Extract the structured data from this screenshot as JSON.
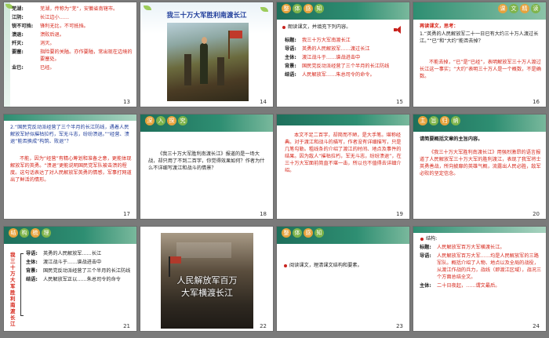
{
  "s13": {
    "num": "13",
    "rows": [
      {
        "k": "芜湖:",
        "v": "芜湖，传称为“芜”，安徽省南辖市。"
      },
      {
        "k": "江阴:",
        "v": "长江边小……"
      },
      {
        "k": "锐不可挡:",
        "v": "锋利无比，不可抵挡。"
      },
      {
        "k": "溃退:",
        "v": "溃败后退。"
      },
      {
        "k": "歼灭:",
        "v": "消灭。"
      },
      {
        "k": "要塞:",
        "v": "指险要的关隘。亦作要隘，常出现在边境的要塞处。"
      },
      {
        "k": "业已:",
        "v": "已经。"
      }
    ]
  },
  "s14": {
    "num": "14",
    "title": "我三十万大军胜利南渡长江"
  },
  "s15": {
    "num": "15",
    "tag": [
      "整",
      "体",
      "感",
      "知"
    ],
    "lead": "朗读课文，并填充下列内容。",
    "rows": [
      {
        "k": "标题:",
        "v": "我三十万大军南渡长江"
      },
      {
        "k": "导语:",
        "v": "英勇的人民解放军……渡过长江"
      },
      {
        "k": "主体:",
        "v": "渡江战斗于……谱战进击中"
      },
      {
        "k": "背景:",
        "v": "国民党反动派经营了三个半月的长江防线"
      },
      {
        "k": "结语:",
        "v": "人民解放军……朱总司令的命令。"
      }
    ]
  },
  "s16": {
    "num": "16",
    "tag": [
      "课",
      "文",
      "精",
      "读"
    ],
    "q_head": "再读课文，思考：",
    "q": "1.“英勇的人民解放军二十一日已有大约三十万人渡过长江。”“已”和“大约”能否去掉？",
    "a": "不能去掉，“已”是“已经”，表明解放军三十万人渡过长江这一事实；“大约”表明三十万人是一个概数，不是确数。"
  },
  "s17": {
    "num": "17",
    "q": "2.“国民党反动派经营了三个半月的长江防线，遇着人民解放军好似摧枯拉朽，军无斗志，纷纷溃退。”“经营、溃退”能否换成“构筑、败退”？",
    "a": "不能，因为“经营”有精心筹划和准备之意，更能体现解放军的英勇。“溃退”更能说明国民党军队被击溃的程度。这句话表达了对人民解放军英勇的情感，军事打网道出了鲜活的情形。"
  },
  "s18": {
    "num": "18",
    "tag": [
      "深",
      "入",
      "探",
      "究"
    ],
    "text": "《我三十万大军胜利南渡长江》报道的是一场大战，却只用了不到二百字，你觉得效果如何？作者为什么不详细写渡江和战斗的情景？"
  },
  "s19": {
    "num": "19",
    "text": "本文不足二百字，却简而不陋，是大手笔。堪称经典。对于渡江和战斗的描写，作者没有详细描写，只是几笔勾勒。粗线条的介绍了渡江的时间、地点及事件的结果。因为敌人“摧枯拉朽，军无斗志，纷纷溃退”，在三十万大军面前简直不堪一击，所以也不值得去详细介绍。"
  },
  "s20": {
    "num": "20",
    "tag": [
      "主",
      "旨",
      "归",
      "纳"
    ],
    "head": "请简要概括文章的主旨内容。",
    "text": "《我三十万大军胜利南渡长江》用强烈激昂的语言报道了人民解放军三十万大军的胜利渡江，表现了我军将士英勇善战，所向披靡的英雄气概，流露出人民必胜，敌军必败的坚定信念。"
  },
  "s21": {
    "num": "21",
    "tag": [
      "结",
      "构",
      "梳",
      "理"
    ],
    "side": "我三十万大军胜利南渡长江",
    "rows": [
      {
        "k": "导语:",
        "v": "英勇的人民解放军……长江"
      },
      {
        "k": "主体:",
        "v": "渡江战斗于……谱战进击中"
      },
      {
        "k": "背景:",
        "v": "国民党反动派经营了三个半月的长江防线"
      },
      {
        "k": "结语:",
        "v": "人民解放军正以……朱总司令的命令"
      }
    ]
  },
  "s22": {
    "num": "22",
    "poster_line1": "人民解放军百万",
    "poster_line2": "大军横渡长江"
  },
  "s23": {
    "num": "23",
    "tag": [
      "整",
      "体",
      "感",
      "知"
    ],
    "lead": "阅读课文，理清课文结构和要素。"
  },
  "s24": {
    "num": "24",
    "head": "结构:",
    "rows": [
      {
        "k": "标题:",
        "v": "人民解放军百万大军横渡长江。"
      },
      {
        "k": "导语:",
        "v": "人民解放军百万大军……均是人民解放军的三路军队。概括介绍了人物、地点以及全局的战役，从渡江作战的兵力，战线（即渡江区域），战况三个方面总结全文。"
      },
      {
        "k": "主体:",
        "v": "二十日夜起，……谓文最后。"
      }
    ]
  },
  "colors": {
    "red": "#d6261a",
    "blue": "#1e3c9a",
    "green": "#2e8e72"
  }
}
